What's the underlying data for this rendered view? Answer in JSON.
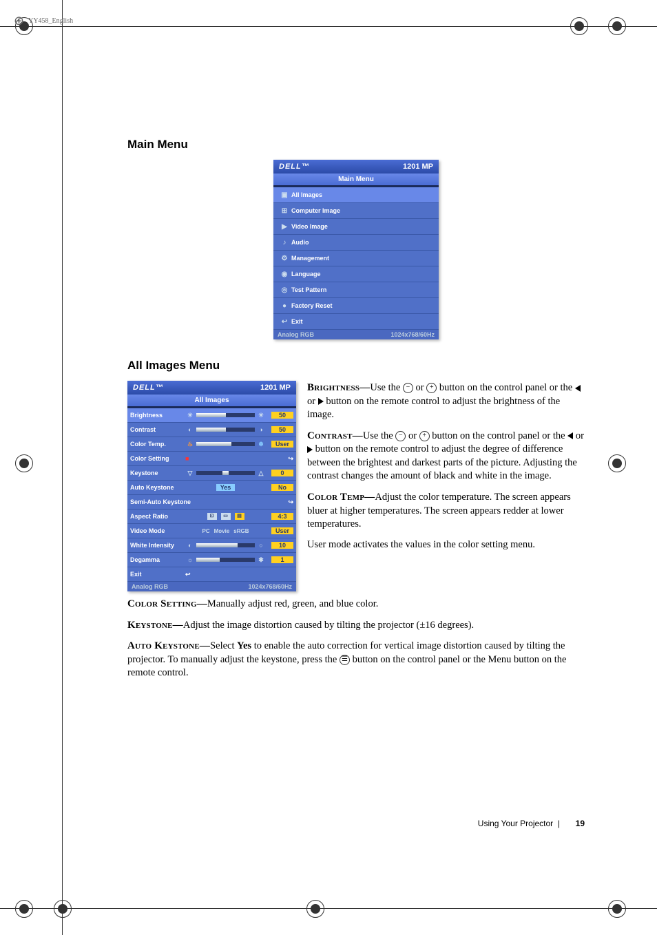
{
  "meta": {
    "filename": "YY458_English"
  },
  "headings": {
    "main": "Main Menu",
    "allimages": "All Images Menu"
  },
  "osd_main": {
    "logo": "DELL™",
    "model": "1201 MP",
    "title": "Main Menu",
    "items": [
      "All Images",
      "Computer Image",
      "Video Image",
      "Audio",
      "Management",
      "Language",
      "Test Pattern",
      "Factory Reset",
      "Exit"
    ],
    "source": "Analog RGB",
    "res": "1024x768/60Hz"
  },
  "osd_img": {
    "logo": "DELL™",
    "model": "1201 MP",
    "title": "All Images",
    "rows": {
      "brightness": {
        "label": "Brightness",
        "value": "50",
        "fill": 50
      },
      "contrast": {
        "label": "Contrast",
        "value": "50",
        "fill": 50
      },
      "colortemp": {
        "label": "Color Temp.",
        "value": "User",
        "fill": 60
      },
      "colorsetting": {
        "label": "Color Setting"
      },
      "keystone": {
        "label": "Keystone",
        "value": "0",
        "fill": 50
      },
      "autokeystone": {
        "label": "Auto Keystone",
        "yes": "Yes",
        "no": "No"
      },
      "semiauto": {
        "label": "Semi-Auto Keystone"
      },
      "aspect": {
        "label": "Aspect Ratio",
        "value": "4:3"
      },
      "videomode": {
        "label": "Video Mode",
        "opts": [
          "PC",
          "Movie",
          "sRGB"
        ],
        "value": "User"
      },
      "whiteint": {
        "label": "White Intensity",
        "value": "10",
        "fill": 70
      },
      "degamma": {
        "label": "Degamma",
        "value": "1",
        "fill": 40
      },
      "exit": {
        "label": "Exit"
      }
    },
    "source": "Analog RGB",
    "res": "1024x768/60Hz"
  },
  "chart_data": {
    "type": "table",
    "title": "All Images OSD settings",
    "rows": [
      {
        "name": "Brightness",
        "value": 50
      },
      {
        "name": "Contrast",
        "value": 50
      },
      {
        "name": "Color Temp.",
        "value": "User"
      },
      {
        "name": "Keystone",
        "value": 0
      },
      {
        "name": "Auto Keystone",
        "value": "No"
      },
      {
        "name": "Aspect Ratio",
        "value": "4:3"
      },
      {
        "name": "Video Mode",
        "value": "User"
      },
      {
        "name": "White Intensity",
        "value": 10
      },
      {
        "name": "Degamma",
        "value": 1
      }
    ]
  },
  "body": {
    "brightness_label": "Brightness—",
    "brightness_text": "Use the ",
    " brightness_text2": " or ",
    " brightness_text3": " button on the control panel or the ",
    " brightness_text4": " or ",
    " brightness_text5": " button on the remote control to adjust the brightness of the image.",
    "contrast_label": "Contrast—",
    "contrast_text": "Use the ",
    " contrast_text2": " or ",
    " contrast_text3": " button on the control panel or the ",
    " contrast_text4": " or ",
    " contrast_text5": " button on the remote control to adjust the degree of difference between the brightest and darkest parts of the picture. Adjusting the contrast changes the amount of black and white in the image.",
    "colortemp_label": "Color Temp—",
    "colortemp_text": "Adjust the color temperature. The screen appears bluer at higher temperatures. The screen appears redder at lower temperatures.",
    "usermode": "User mode activates the values in the color setting menu.",
    "colorsetting_label": "Color Setting—",
    "colorsetting_text": "Manually adjust red, green, and blue color.",
    "keystone_label": "Keystone—",
    "keystone_text": "Adjust the image distortion caused by tilting the projector (±16 degrees).",
    "autokeystone_label": "Auto Keystone—",
    "autokeystone_text1": "Select ",
    "autokeystone_yes": "Yes",
    "autokeystone_text2": " to enable the auto correction for vertical image distortion caused by tilting the projector.  To manually adjust the keystone, press the ",
    " autokeystone_text3": " button on the control panel or the Menu button on the remote control."
  },
  "footer": {
    "text": "Using Your Projector",
    "page": "19"
  }
}
